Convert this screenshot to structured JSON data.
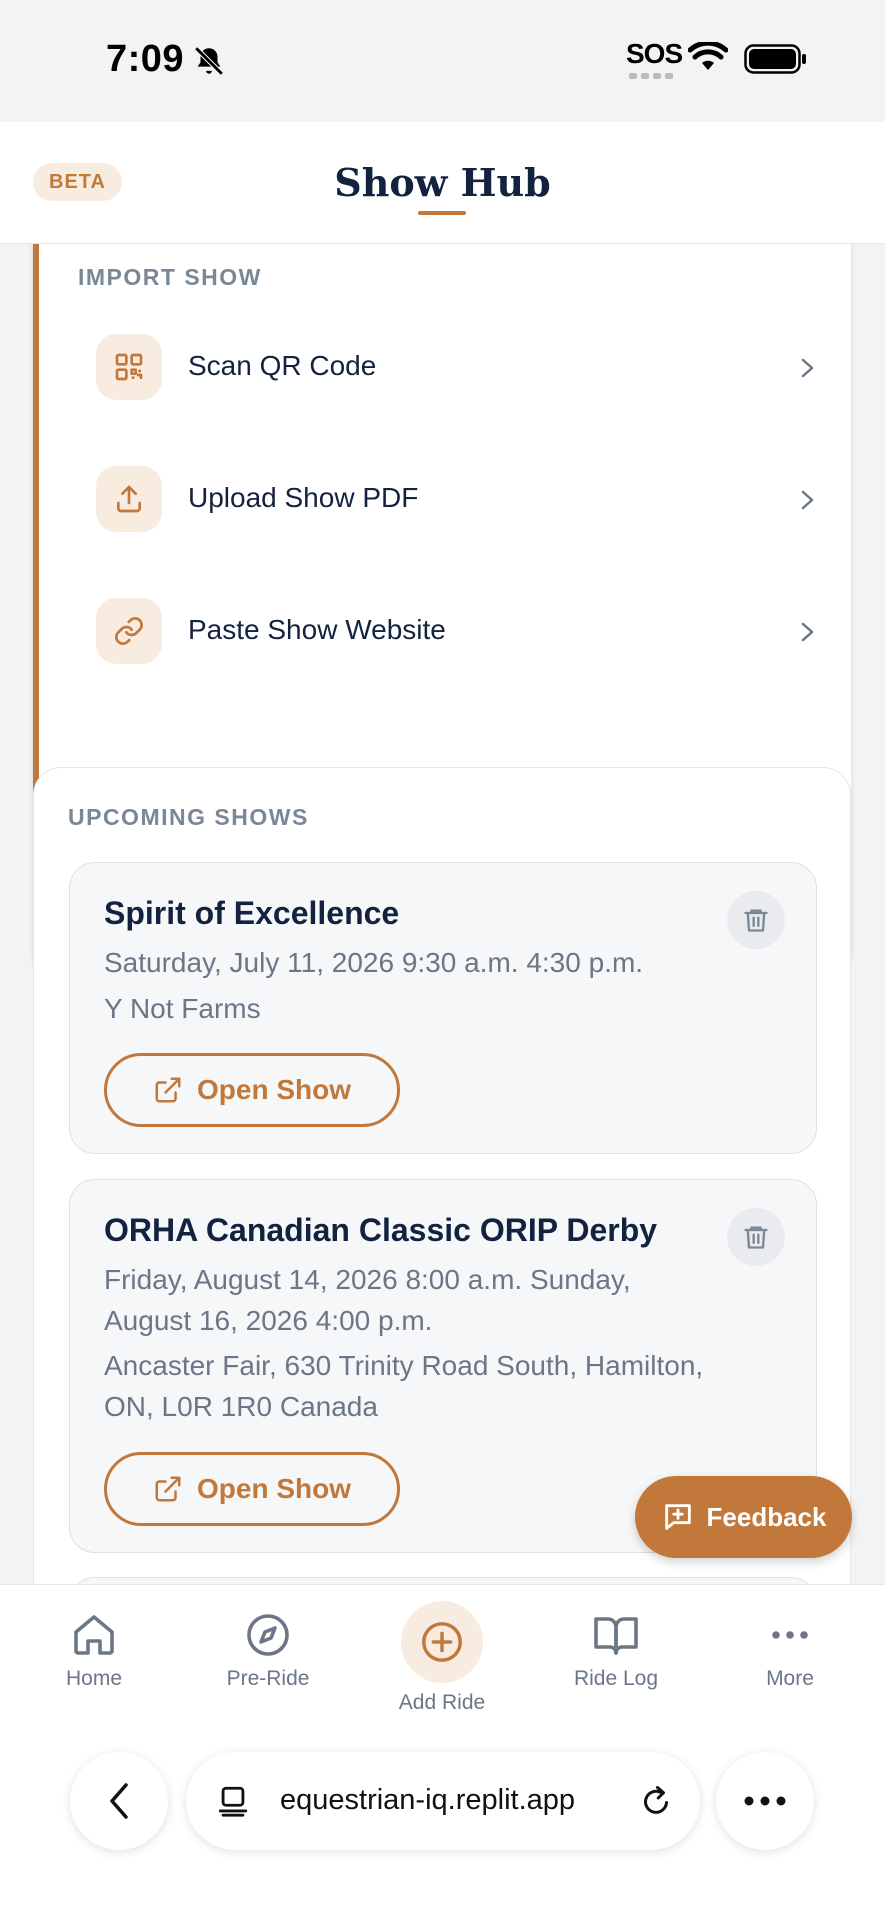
{
  "status_bar": {
    "time": "7:09",
    "carrier": "SOS"
  },
  "header": {
    "badge": "BETA",
    "title": "Show Hub"
  },
  "import_show": {
    "section_label": "IMPORT SHOW",
    "options": [
      {
        "label": "Scan QR Code",
        "icon": "qr-code-icon"
      },
      {
        "label": "Upload Show PDF",
        "icon": "upload-icon"
      },
      {
        "label": "Paste Show Website",
        "icon": "link-icon"
      }
    ]
  },
  "upcoming": {
    "section_label": "UPCOMING SHOWS",
    "shows": [
      {
        "title": "Spirit of Excellence",
        "dates": "Saturday, July 11, 2026 9:30 a.m. 4:30 p.m.",
        "location": "Y Not Farms",
        "button_label": "Open Show"
      },
      {
        "title": "ORHA Canadian Classic ORIP Derby",
        "dates": "Friday, August 14, 2026 8:00 a.m. Sunday, August 16, 2026 4:00 p.m.",
        "location": "Ancaster Fair, 630 Trinity Road South, Hamilton, ON, L0R 1R0 Canada",
        "button_label": "Open Show"
      }
    ]
  },
  "feedback": {
    "label": "Feedback"
  },
  "bottom_nav": [
    {
      "label": "Home",
      "icon": "home-icon"
    },
    {
      "label": "Pre-Ride",
      "icon": "compass-icon"
    },
    {
      "label": "Add Ride",
      "icon": "plus-circle-icon"
    },
    {
      "label": "Ride Log",
      "icon": "book-icon"
    },
    {
      "label": "More",
      "icon": "more-icon"
    }
  ],
  "browser": {
    "url": "equestrian-iq.replit.app"
  },
  "colors": {
    "accent": "#c2783a",
    "accent_light": "#f8ece0",
    "navy": "#13233f",
    "muted": "#6b7686"
  }
}
